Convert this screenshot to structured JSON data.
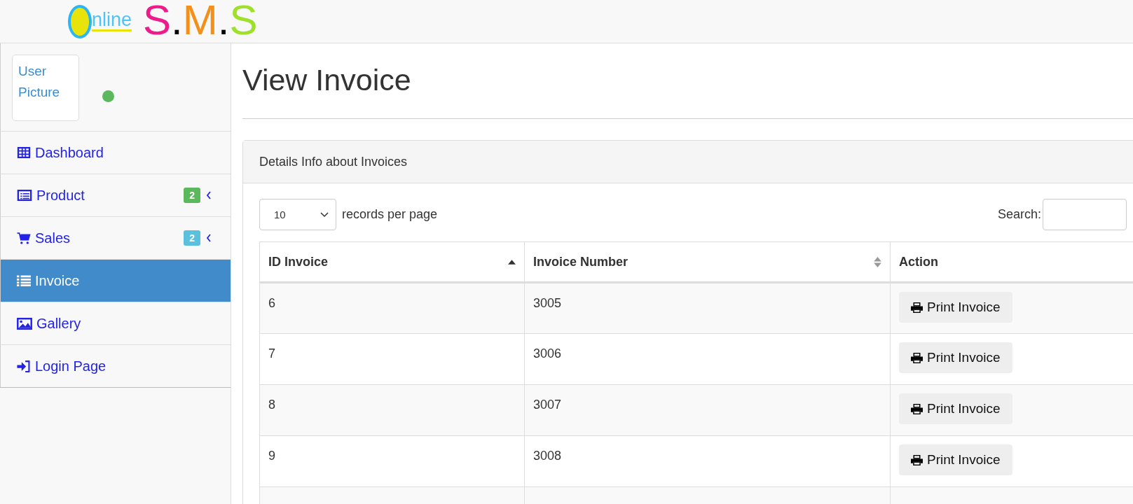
{
  "logo": {
    "word": "nline",
    "title": "S.M.S"
  },
  "user": {
    "picture_alt": "User Picture",
    "online": true
  },
  "sidebar": {
    "items": [
      {
        "label": "Dashboard",
        "selected": false
      },
      {
        "label": "Product",
        "selected": false,
        "badge": "2",
        "color": "#5cb85c",
        "expandable": true
      },
      {
        "label": "Sales",
        "selected": false,
        "badge": "2",
        "color": "#5bc0de",
        "expandable": true
      },
      {
        "label": "Invoice",
        "selected": true
      },
      {
        "label": "Gallery",
        "selected": false
      },
      {
        "label": "Login Page",
        "selected": false
      }
    ]
  },
  "page_title": "View Invoice",
  "panel": {
    "heading": "Details Info about Invoices",
    "page_size": "10",
    "page_size_label": "records per page",
    "search_label": "Search:",
    "table": {
      "columns": [
        {
          "label": "ID Invoice",
          "sortable": true,
          "sorted": true
        },
        {
          "label": "Invoice Number",
          "sortable": true,
          "sorted": false
        },
        {
          "label": "Action"
        }
      ],
      "rows": [
        {
          "id": "6",
          "number": "3005",
          "action": "Print Invoice"
        },
        {
          "id": "7",
          "number": "3006",
          "action": "Print Invoice"
        },
        {
          "id": "8",
          "number": "3007",
          "action": "Print Invoice"
        },
        {
          "id": "9",
          "number": "3008",
          "action": "Print Invoice"
        }
      ]
    }
  }
}
